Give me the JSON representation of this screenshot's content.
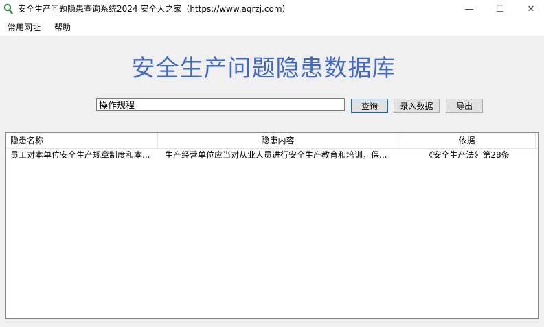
{
  "window": {
    "title": "安全生产问题隐患查询系统2024  安全人之家（https://www.aqrzj.com）",
    "icon": "magnifier-icon",
    "controls": {
      "minimize": "—",
      "maximize": "☐",
      "close": "✕"
    }
  },
  "menu": {
    "items": [
      {
        "label": "常用网址"
      },
      {
        "label": "帮助"
      }
    ]
  },
  "main": {
    "title": "安全生产问题隐患数据库",
    "accent_color": "#4169c8"
  },
  "search": {
    "value": "操作规程",
    "query_label": "查询",
    "insert_label": "录入数据",
    "export_label": "导出"
  },
  "table": {
    "columns": [
      "隐患名称",
      "隐患内容",
      "依据"
    ],
    "rows": [
      {
        "name": "员工对本单位安全生产规章制度和本...",
        "content": "生产经营单位应当对从业人员进行安全生产教育和培训，保...",
        "basis": "《安全生产法》第28条"
      }
    ]
  }
}
